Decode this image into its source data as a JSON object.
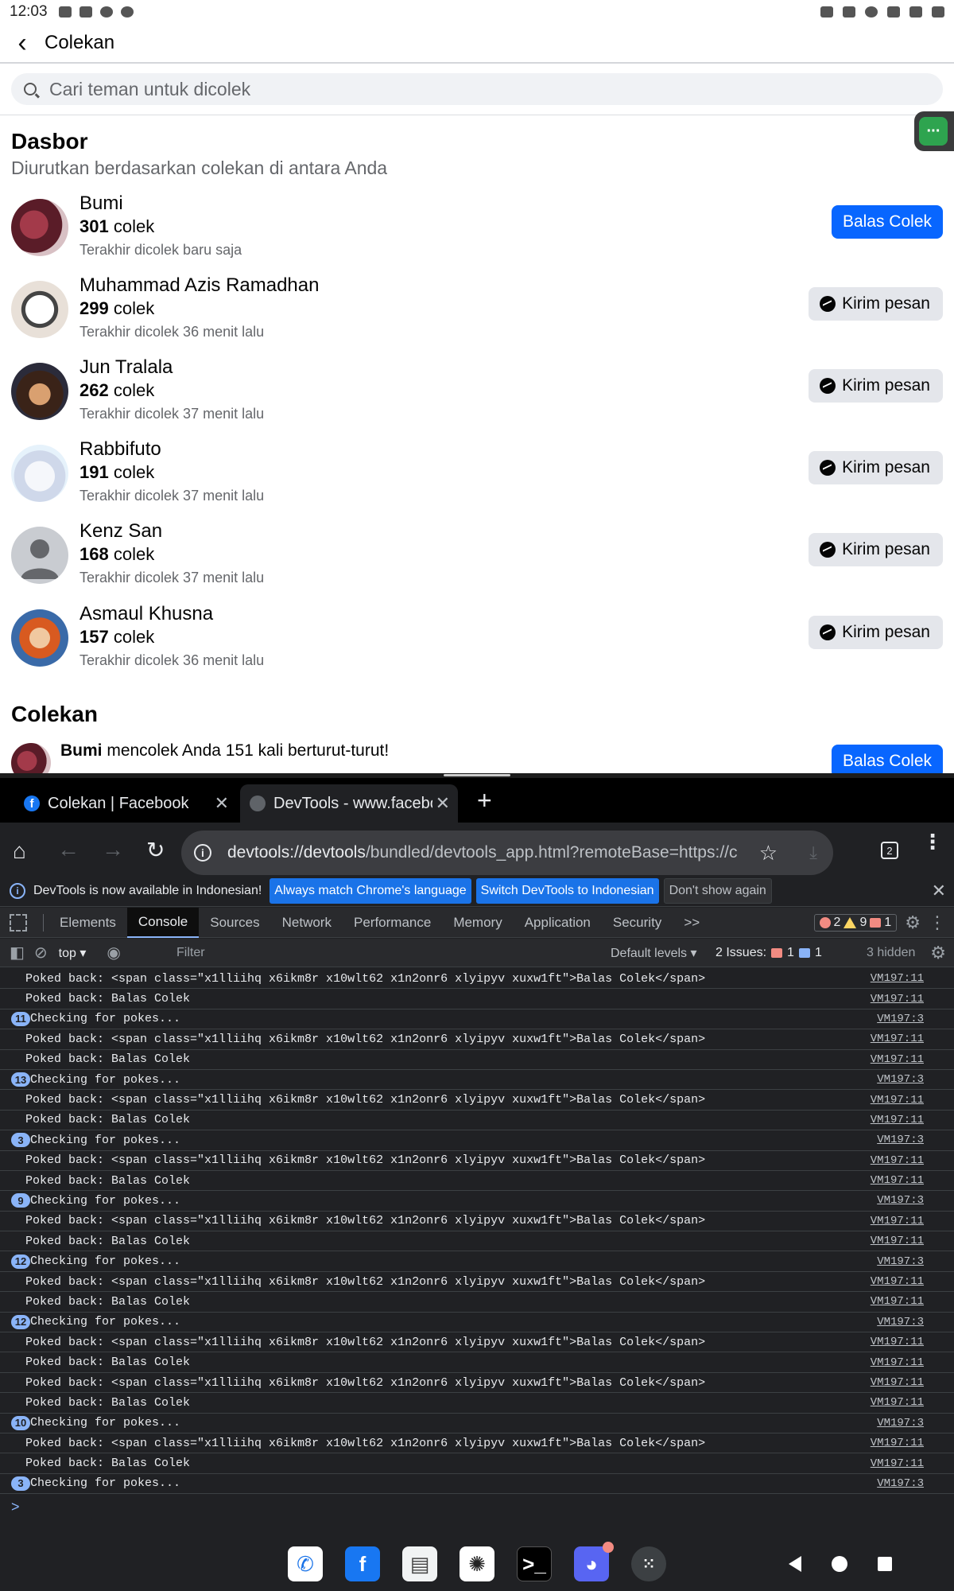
{
  "status_bar": {
    "time": "12:03"
  },
  "header": {
    "title": "Colekan"
  },
  "search": {
    "placeholder": "Cari teman untuk dicolek"
  },
  "dashboard": {
    "title": "Dasbor",
    "subtitle": "Diurutkan berdasarkan colekan di antara Anda",
    "unit": "colek",
    "rows": [
      {
        "name": "Bumi",
        "count": "301",
        "last": "Terakhir dicolek baru saja",
        "button": "Balas Colek"
      },
      {
        "name": "Muhammad Azis Ramadhan",
        "count": "299",
        "last": "Terakhir dicolek 36 menit lalu",
        "button": "Kirim pesan"
      },
      {
        "name": "Jun Tralala",
        "count": "262",
        "last": "Terakhir dicolek 37 menit lalu",
        "button": "Kirim pesan"
      },
      {
        "name": "Rabbifuto",
        "count": "191",
        "last": "Terakhir dicolek 37 menit lalu",
        "button": "Kirim pesan"
      },
      {
        "name": "Kenz San",
        "count": "168",
        "last": "Terakhir dicolek 37 menit lalu",
        "button": "Kirim pesan"
      },
      {
        "name": "Asmaul Khusna",
        "count": "157",
        "last": "Terakhir dicolek 36 menit lalu",
        "button": "Kirim pesan"
      }
    ]
  },
  "pokes": {
    "title": "Colekan",
    "item": {
      "name": "Bumi",
      "text": " mencolek Anda 151 kali berturut-turut!",
      "button": "Balas Colek"
    }
  },
  "browser": {
    "tabs": [
      {
        "title": "Colekan | Facebook"
      },
      {
        "title": "DevTools - www.faceboo"
      }
    ],
    "new_tab": "+",
    "url_bold": "devtools://devtools",
    "url_rest": "/bundled/devtools_app.html?remoteBase=https://c",
    "tab_count": "2"
  },
  "devtools": {
    "infobar": {
      "message": "DevTools is now available in Indonesian!",
      "btn_match": "Always match Chrome's language",
      "btn_switch": "Switch DevTools to Indonesian",
      "btn_dismiss": "Don't show again"
    },
    "tabs": [
      "Elements",
      "Console",
      "Sources",
      "Network",
      "Performance",
      "Memory",
      "Application",
      "Security"
    ],
    "more": ">>",
    "counts": {
      "errors": "2",
      "warnings": "9",
      "issues_badge": "1"
    },
    "filterbar": {
      "context": "top",
      "filter_placeholder": "Filter",
      "levels": "Default levels ▾",
      "issues_label": "2 Issues:",
      "issues_err": "1",
      "issues_info": "1",
      "hidden": "3 hidden"
    },
    "logs": [
      {
        "badge": "",
        "msg": "Poked back: <span class=\"x1lliihq x6ikm8r x10wlt62 x1n2onr6 xlyipyv xuxw1ft\">Balas Colek</span>",
        "src": "VM197:11"
      },
      {
        "badge": "",
        "msg": "Poked back: Balas Colek",
        "src": "VM197:11"
      },
      {
        "badge": "11",
        "msg": "Checking for pokes...",
        "src": "VM197:3"
      },
      {
        "badge": "",
        "msg": "Poked back: <span class=\"x1lliihq x6ikm8r x10wlt62 x1n2onr6 xlyipyv xuxw1ft\">Balas Colek</span>",
        "src": "VM197:11"
      },
      {
        "badge": "",
        "msg": "Poked back: Balas Colek",
        "src": "VM197:11"
      },
      {
        "badge": "13",
        "msg": "Checking for pokes...",
        "src": "VM197:3"
      },
      {
        "badge": "",
        "msg": "Poked back: <span class=\"x1lliihq x6ikm8r x10wlt62 x1n2onr6 xlyipyv xuxw1ft\">Balas Colek</span>",
        "src": "VM197:11"
      },
      {
        "badge": "",
        "msg": "Poked back: Balas Colek",
        "src": "VM197:11"
      },
      {
        "badge": "3",
        "msg": "Checking for pokes...",
        "src": "VM197:3"
      },
      {
        "badge": "",
        "msg": "Poked back: <span class=\"x1lliihq x6ikm8r x10wlt62 x1n2onr6 xlyipyv xuxw1ft\">Balas Colek</span>",
        "src": "VM197:11"
      },
      {
        "badge": "",
        "msg": "Poked back: Balas Colek",
        "src": "VM197:11"
      },
      {
        "badge": "9",
        "msg": "Checking for pokes...",
        "src": "VM197:3"
      },
      {
        "badge": "",
        "msg": "Poked back: <span class=\"x1lliihq x6ikm8r x10wlt62 x1n2onr6 xlyipyv xuxw1ft\">Balas Colek</span>",
        "src": "VM197:11"
      },
      {
        "badge": "",
        "msg": "Poked back: Balas Colek",
        "src": "VM197:11"
      },
      {
        "badge": "12",
        "msg": "Checking for pokes...",
        "src": "VM197:3"
      },
      {
        "badge": "",
        "msg": "Poked back: <span class=\"x1lliihq x6ikm8r x10wlt62 x1n2onr6 xlyipyv xuxw1ft\">Balas Colek</span>",
        "src": "VM197:11"
      },
      {
        "badge": "",
        "msg": "Poked back: Balas Colek",
        "src": "VM197:11"
      },
      {
        "badge": "12",
        "msg": "Checking for pokes...",
        "src": "VM197:3"
      },
      {
        "badge": "",
        "msg": "Poked back: <span class=\"x1lliihq x6ikm8r x10wlt62 x1n2onr6 xlyipyv xuxw1ft\">Balas Colek</span>",
        "src": "VM197:11"
      },
      {
        "badge": "",
        "msg": "Poked back: Balas Colek",
        "src": "VM197:11"
      },
      {
        "badge": "",
        "msg": "Poked back: <span class=\"x1lliihq x6ikm8r x10wlt62 x1n2onr6 xlyipyv xuxw1ft\">Balas Colek</span>",
        "src": "VM197:11"
      },
      {
        "badge": "",
        "msg": "Poked back: Balas Colek",
        "src": "VM197:11"
      },
      {
        "badge": "10",
        "msg": "Checking for pokes...",
        "src": "VM197:3"
      },
      {
        "badge": "",
        "msg": "Poked back: <span class=\"x1lliihq x6ikm8r x10wlt62 x1n2onr6 xlyipyv xuxw1ft\">Balas Colek</span>",
        "src": "VM197:11"
      },
      {
        "badge": "",
        "msg": "Poked back: Balas Colek",
        "src": "VM197:11"
      },
      {
        "badge": "3",
        "msg": "Checking for pokes...",
        "src": "VM197:3"
      }
    ],
    "prompt": ">"
  },
  "colors": {
    "fb_blue": "#0866ff",
    "devtools_bg": "#202124",
    "badge_blue": "#8ab4f8"
  },
  "dock_apps": [
    "phone-icon",
    "facebook-icon",
    "gallery-icon",
    "chatgpt-icon",
    "terminal-icon",
    "discord-icon",
    "app-drawer-icon"
  ]
}
